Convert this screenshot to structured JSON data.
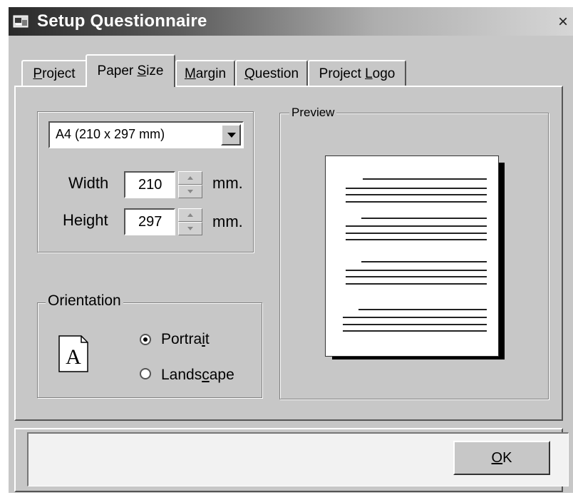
{
  "window": {
    "title": "Setup Questionnaire",
    "close_glyph": "×"
  },
  "tabs": [
    {
      "label_pre": "",
      "mnemonic": "P",
      "label_post": "roject"
    },
    {
      "label_pre": "Paper ",
      "mnemonic": "S",
      "label_post": "ize"
    },
    {
      "label_pre": "",
      "mnemonic": "M",
      "label_post": "argin"
    },
    {
      "label_pre": "",
      "mnemonic": "Q",
      "label_post": "uestion"
    },
    {
      "label_pre": "Project ",
      "mnemonic": "L",
      "label_post": "ogo"
    }
  ],
  "paper": {
    "size_selected": "A4 (210 x 297 mm)",
    "width_label": "Width",
    "width_value": "210",
    "height_label": "Height",
    "height_value": "297",
    "unit_label": "mm."
  },
  "orientation": {
    "legend": "Orientation",
    "icon_letter": "A",
    "portrait_pre": "Portra",
    "portrait_mnemonic": "i",
    "portrait_post": "t",
    "landscape_pre": "Lands",
    "landscape_mnemonic": "c",
    "landscape_post": "ape",
    "selected": "portrait"
  },
  "preview": {
    "legend": "Preview"
  },
  "footer": {
    "ok_mnemonic": "O",
    "ok_post": "K"
  },
  "icons": [
    "app-icon",
    "close-icon",
    "dropdown-arrow-icon",
    "spin-up-icon",
    "spin-down-icon",
    "portrait-page-icon"
  ]
}
